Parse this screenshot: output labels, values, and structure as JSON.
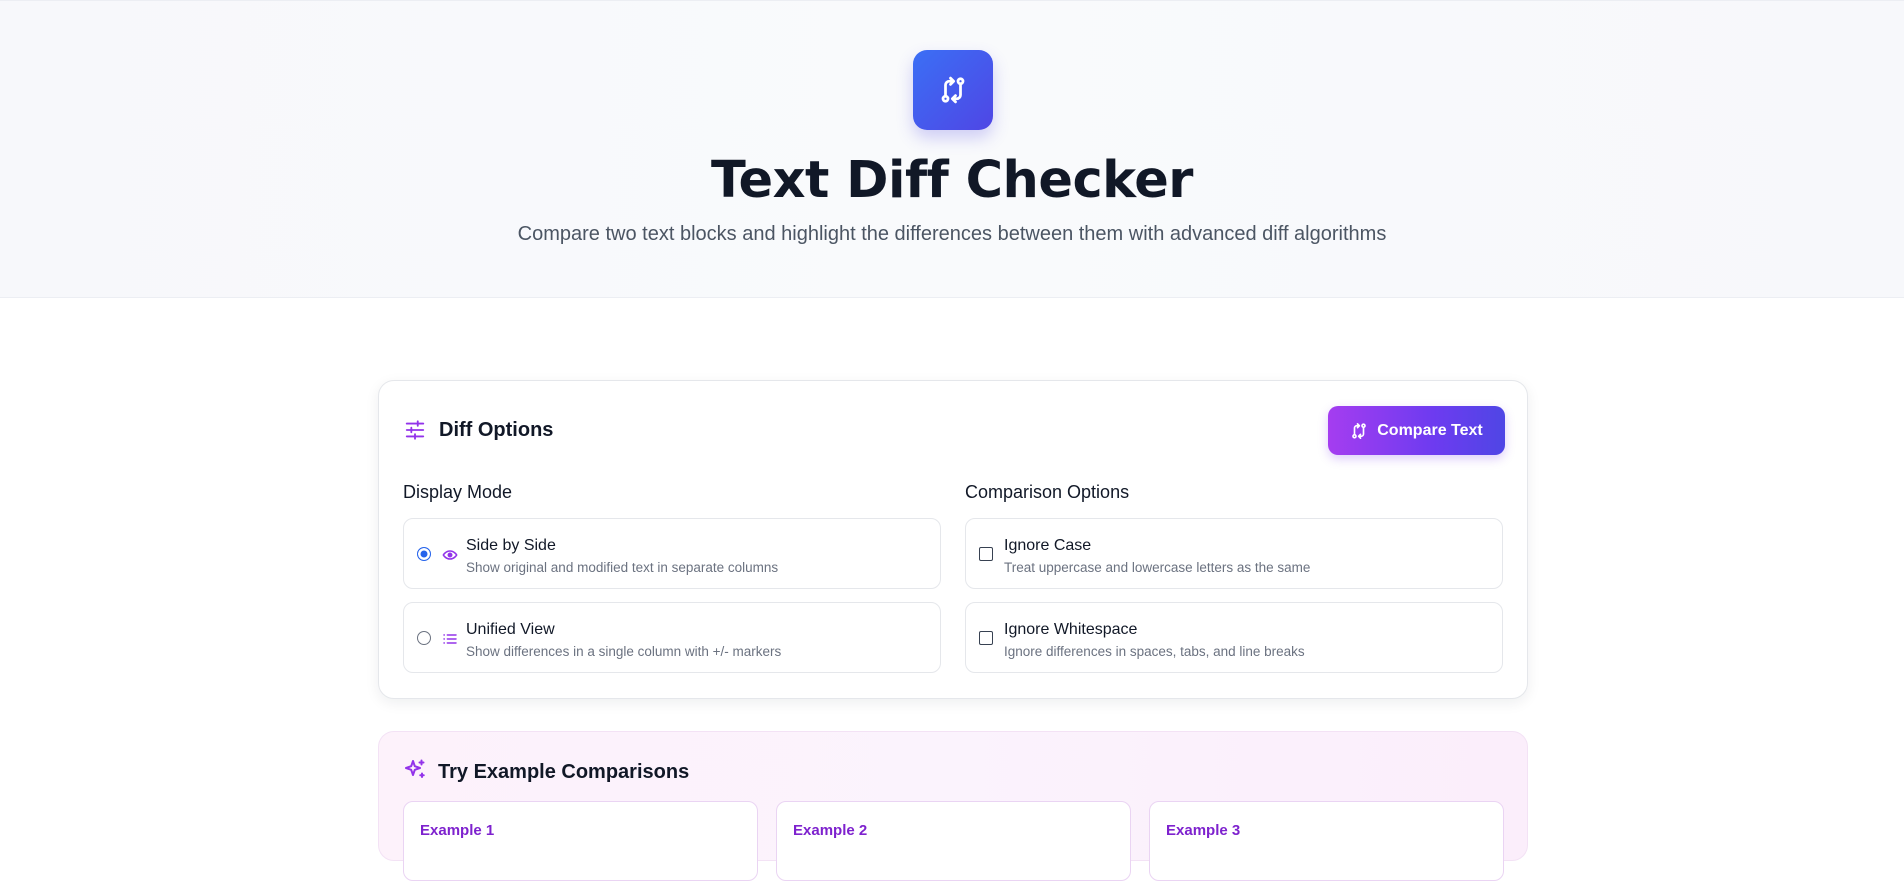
{
  "hero": {
    "logo_icon": "compare-arrows-icon",
    "title": "Text Diff Checker",
    "subtitle": "Compare two text blocks and highlight the differences between them with advanced diff algorithms"
  },
  "options_card": {
    "icon": "sliders-icon",
    "title": "Diff Options",
    "compare_button": {
      "icon": "compare-arrows-icon",
      "label": "Compare Text"
    },
    "display_mode": {
      "label": "Display Mode",
      "options": [
        {
          "title": "Side by Side",
          "desc": "Show original and modified text in separate columns",
          "icon": "eye-icon",
          "selected": true
        },
        {
          "title": "Unified View",
          "desc": "Show differences in a single column with +/- markers",
          "icon": "list-icon",
          "selected": false
        }
      ]
    },
    "comparison": {
      "label": "Comparison Options",
      "options": [
        {
          "title": "Ignore Case",
          "desc": "Treat uppercase and lowercase letters as the same",
          "checked": false
        },
        {
          "title": "Ignore Whitespace",
          "desc": "Ignore differences in spaces, tabs, and line breaks",
          "checked": false
        }
      ]
    }
  },
  "examples": {
    "icon": "sparkles-icon",
    "title": "Try Example Comparisons",
    "items": [
      {
        "label": "Example 1"
      },
      {
        "label": "Example 2"
      },
      {
        "label": "Example 3"
      }
    ]
  },
  "colors": {
    "accent_purple": "#9333ea",
    "accent_indigo": "#4f46e5",
    "radio_blue": "#2563eb"
  }
}
